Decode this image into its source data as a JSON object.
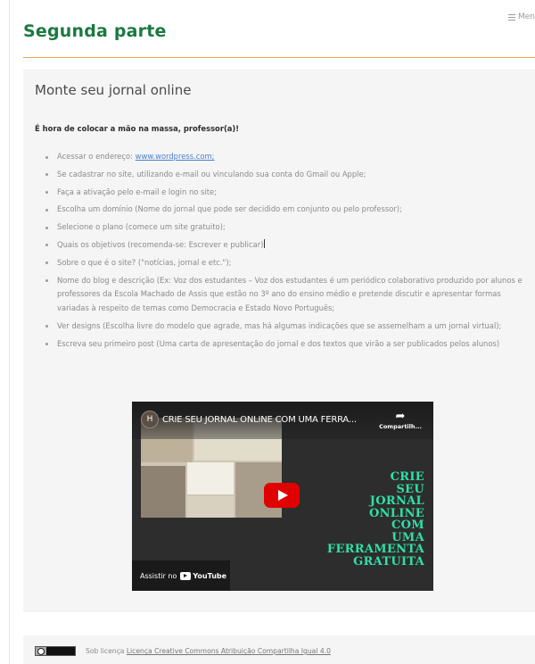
{
  "header": {
    "menu_label": "Men"
  },
  "page": {
    "title": "Segunda parte"
  },
  "card": {
    "heading": "Monte seu jornal online",
    "intro": "É hora de colocar a mão na massa, professor(a)!",
    "items": [
      {
        "text": "Acessar o endereço: ",
        "link": "www.wordpress.com;"
      },
      {
        "text": "Se cadastrar no site, utilizando e-mail ou vinculando sua conta do Gmail ou Apple;"
      },
      {
        "text": "Faça a ativação pelo e-mail e login no site;"
      },
      {
        "text": "Escolha um domínio (Nome do jornal que pode ser decidido em conjunto ou pelo professor);"
      },
      {
        "text": "Selecione o plano (comece um site gratuito);"
      },
      {
        "text": "Quais os objetivos (recomenda-se: Escrever e publicar)"
      },
      {
        "text": "Sobre o que é o site? (\"notícias, jornal e etc.\");"
      },
      {
        "text": "Nome do blog e descrição (Ex: Voz dos estudantes – Voz dos estudantes é um periódico colaborativo produzido por alunos e professores da Escola Machado de Assis que estão no 3º ano do ensino médio e pretende discutir e apresentar formas variadas à respeito de temas como Democracia e Estado Novo Português;"
      },
      {
        "text": "Ver designs (Escolha livre do modelo que agrade, mas há algumas indicações que se assemelham a um jornal virtual);"
      },
      {
        "text": "Escreva seu primeiro post (Uma carta de apresentação do jornal e dos textos que virão a ser publicados pelos alunos)"
      }
    ]
  },
  "video": {
    "channel_initial": "H",
    "title": "CRIE SEU JORNAL ONLINE COM UMA FERRA...",
    "share_label": "Compartilh...",
    "thumbnail_lines": [
      "CRIE",
      "SEU",
      "JORNAL",
      "ONLINE",
      "COM",
      "UMA",
      "FERRAMENTA",
      "GRATUITA"
    ],
    "watch_label": "Assistir no",
    "yt_label": "YouTube",
    "colors": {
      "accent_text": "#2fe0a8",
      "play_button": "#e00000"
    }
  },
  "footer": {
    "prefix": "Sob licença ",
    "license_link": "Licença Creative Commons Atribuição Compartilha Igual 4.0"
  },
  "colors": {
    "title_green": "#1a7a40",
    "rule_orange": "#f0a04b",
    "link_blue": "#4a7fd0"
  }
}
